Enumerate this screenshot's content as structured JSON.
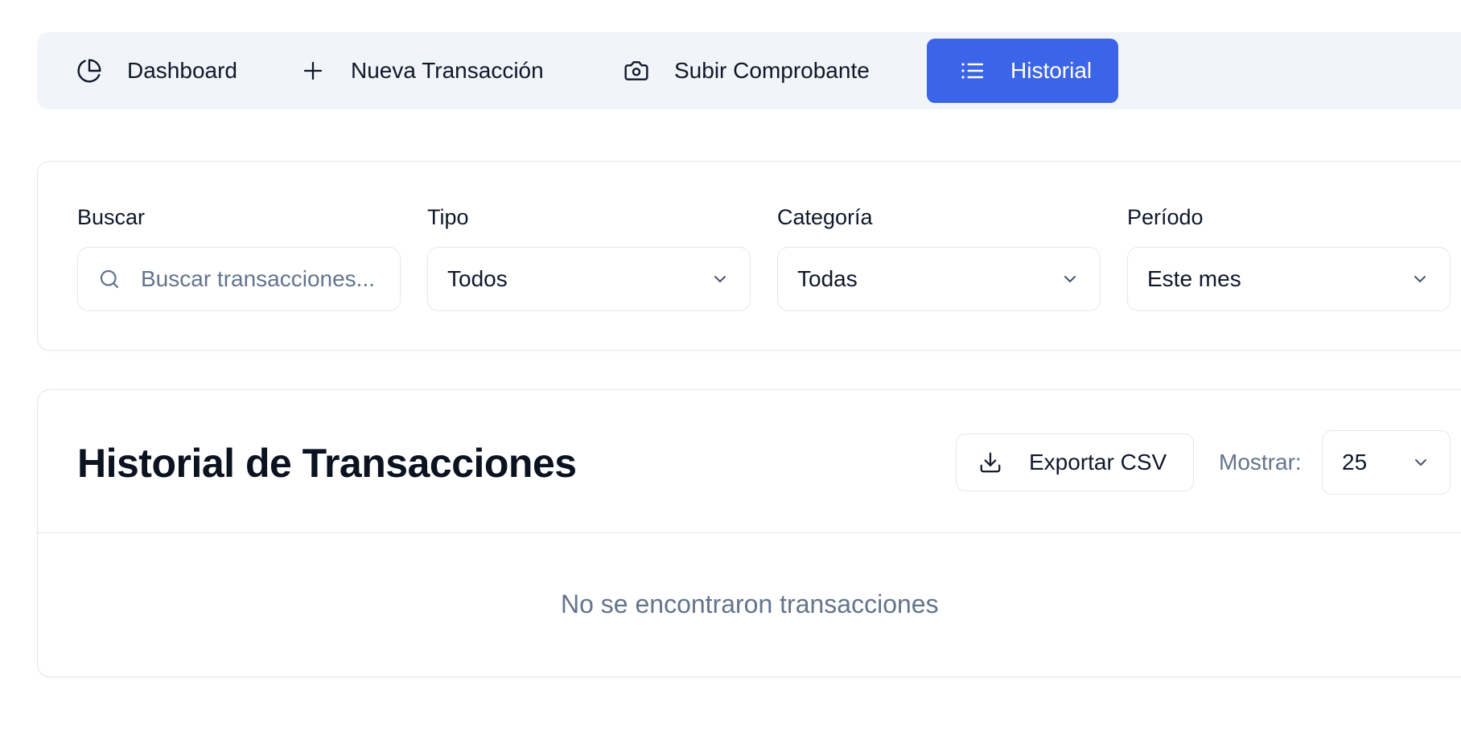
{
  "nav": {
    "tabs": [
      {
        "label": "Dashboard",
        "icon": "pie-chart-icon",
        "active": false
      },
      {
        "label": "Nueva Transacción",
        "icon": "plus-icon",
        "active": false
      },
      {
        "label": "Subir Comprobante",
        "icon": "camera-icon",
        "active": false
      },
      {
        "label": "Historial",
        "icon": "list-icon",
        "active": true
      }
    ],
    "active_color": "#3b64e8"
  },
  "filters": {
    "search": {
      "label": "Buscar",
      "placeholder": "Buscar transacciones...",
      "value": ""
    },
    "type": {
      "label": "Tipo",
      "value": "Todos"
    },
    "category": {
      "label": "Categoría",
      "value": "Todas"
    },
    "period": {
      "label": "Período",
      "value": "Este mes"
    }
  },
  "history": {
    "title": "Historial de Transacciones",
    "export_label": "Exportar CSV",
    "show_label": "Mostrar:",
    "show_value": "25",
    "empty_message": "No se encontraron transacciones"
  }
}
